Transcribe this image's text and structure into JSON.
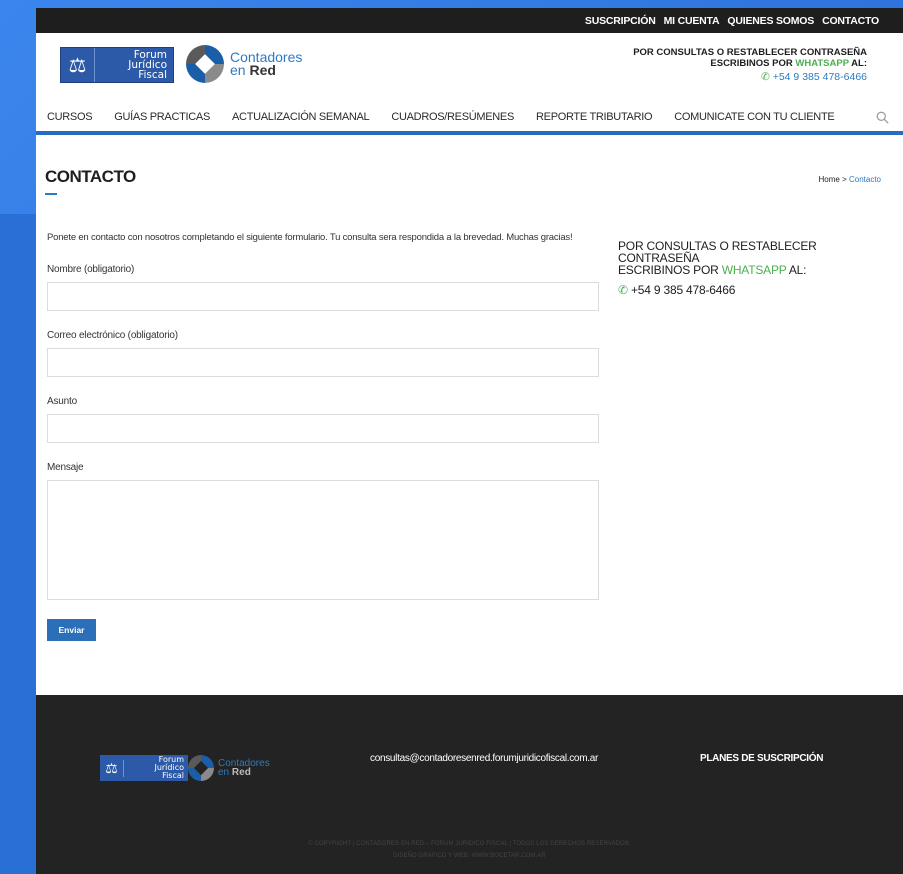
{
  "topbar": {
    "links": [
      "SUSCRIPCIÓN",
      "MI CUENTA",
      "QUIENES SOMOS",
      "CONTACTO"
    ]
  },
  "logos": {
    "fjf": {
      "line1": "Forum",
      "line2": "Jurídico",
      "line3": "Fiscal"
    },
    "cer": {
      "line1": "Contadores",
      "line2a": "en ",
      "line2b": "Red"
    }
  },
  "header_contact": {
    "line1": "POR CONSULTAS O RESTABLECER CONTRASEÑA",
    "line2_pre": "ESCRIBINOS POR ",
    "line2_wa": "WHATSAPP",
    "line2_post": " AL:",
    "phone": "+54 9 385 478-6466"
  },
  "nav": {
    "items": [
      "CURSOS",
      "GUÍAS PRACTICAS",
      "ACTUALIZACIÓN SEMANAL",
      "CUADROS/RESÚMENES",
      "REPORTE TRIBUTARIO",
      "COMUNICATE CON TU CLIENTE"
    ]
  },
  "page": {
    "title": "CONTACTO",
    "breadcrumb_home": "Home",
    "breadcrumb_sep": " > ",
    "breadcrumb_current": "Contacto",
    "intro": "Ponete en contacto con nosotros completando el siguiente formulario. Tu consulta sera respondida a la brevedad. Muchas gracias!"
  },
  "form": {
    "name_label": "Nombre (obligatorio)",
    "email_label": "Correo electrónico (obligatorio)",
    "subject_label": "Asunto",
    "message_label": "Mensaje",
    "submit_label": "Enviar"
  },
  "sidebar": {
    "line1": "POR CONSULTAS O RESTABLECER CONTRASEÑA",
    "line2_pre": "ESCRIBINOS POR ",
    "line2_wa": "WHATSAPP",
    "line2_post": " AL:",
    "phone": "+54 9 385 478-6466"
  },
  "footer": {
    "email": "consultas@contadoresenred.forumjuridicofiscal.com.ar",
    "plans": "PLANES DE SUSCRIPCIÓN",
    "copyright1": "© COPYRIGHT | CONTADORES EN RED – FORUM JURÍDICO FISCAL | TODOS LOS DERECHOS RESERVADOS.",
    "copyright2": "DISEÑO GRÁFICO Y WEB: WWW.BOCETAR.COM.AR"
  },
  "colors": {
    "accent": "#2b6fb8",
    "whatsapp": "#4caf50",
    "background": "#2a6fd6",
    "footer": "#232323"
  }
}
